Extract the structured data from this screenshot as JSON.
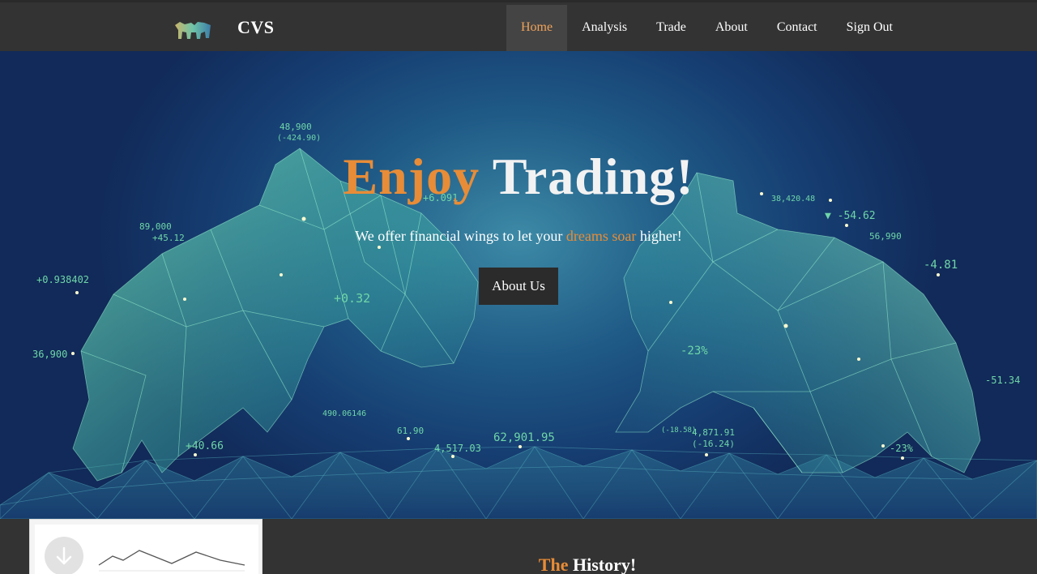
{
  "nav": {
    "brand": "CVS",
    "items": [
      {
        "label": "Home",
        "active": true
      },
      {
        "label": "Analysis"
      },
      {
        "label": "Trade"
      },
      {
        "label": "About"
      },
      {
        "label": "Contact"
      },
      {
        "label": "Sign Out"
      }
    ]
  },
  "hero": {
    "title_part1": "Enjoy",
    "title_part2": "Trading!",
    "subtitle_part1": "We offer financial wings to let your",
    "subtitle_highlight": "dreams soar",
    "subtitle_part2": "higher!",
    "button_label": "About Us",
    "numbers": {
      "n1": "48,900",
      "n2": "(-424.90)",
      "n3": "89,000",
      "n4": "+45.12",
      "n5": "+0.938402",
      "n6": "+0.32",
      "n7": "36,900",
      "n8": "+40.66",
      "n9": "490.06146",
      "n10": "61.90",
      "n11": "4,517.03",
      "n12": "62,901.95",
      "n13": "38,420.48",
      "n14": "▼ -54.62",
      "n15": "-4.81",
      "n16": "-23%",
      "n17": "4,871.91",
      "n18": "(-16.24)",
      "n19": "(-18.58)",
      "n20": "-23%",
      "n21": "-51.34",
      "n22": "+6.091",
      "n23": "56,990"
    }
  },
  "section": {
    "history_part1": "The",
    "history_part2": "History!"
  },
  "colors": {
    "accent": "#e88c37",
    "nav_bg": "#333333",
    "hero_mid": "#1f5a86"
  },
  "icons": {
    "logo": "bull-bear-logo-icon",
    "download": "download-arrow-icon"
  }
}
